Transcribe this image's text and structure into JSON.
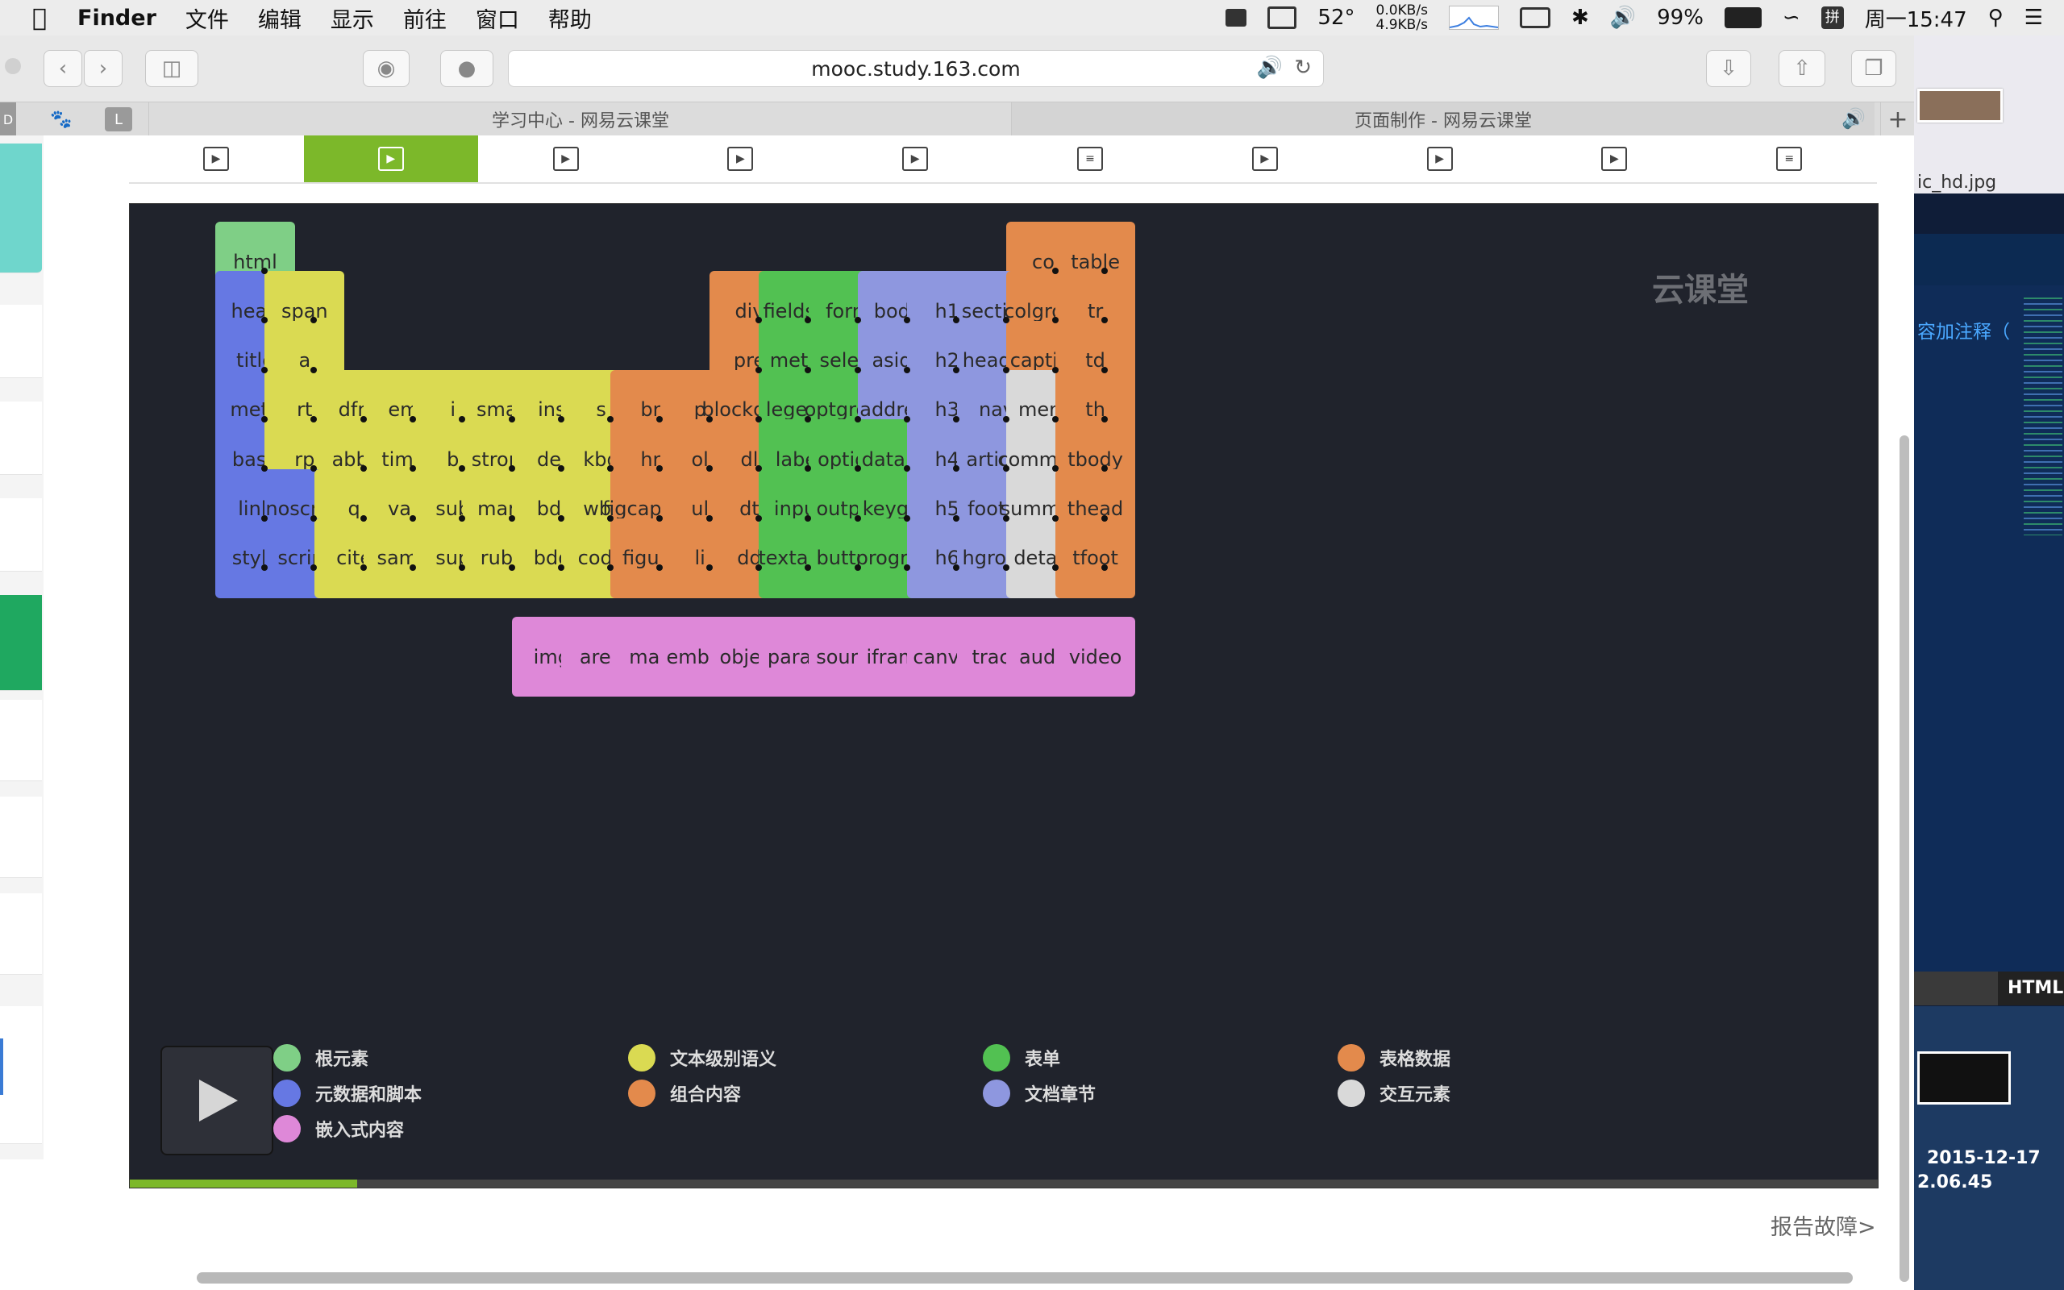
{
  "menubar": {
    "apple_icon": "apple-icon",
    "app_name": "Finder",
    "items": [
      "文件",
      "编辑",
      "显示",
      "前往",
      "窗口",
      "帮助"
    ],
    "temperature": "52°",
    "net_up": "0.0KB/s",
    "net_down": "4.9KB/s",
    "battery": "99%",
    "clock": "周一15:47"
  },
  "browser": {
    "url": "mooc.study.163.com",
    "tabs": [
      {
        "label": "学习中心 - 网易云课堂"
      },
      {
        "label": "页面制作 - 网易云课堂"
      }
    ],
    "new_tab": "+"
  },
  "lesson_tabs": [
    {
      "type": "video",
      "active": false
    },
    {
      "type": "video",
      "active": true
    },
    {
      "type": "video",
      "active": false
    },
    {
      "type": "video",
      "active": false
    },
    {
      "type": "video",
      "active": false
    },
    {
      "type": "doc",
      "active": false
    },
    {
      "type": "video",
      "active": false
    },
    {
      "type": "video",
      "active": false
    },
    {
      "type": "video",
      "active": false
    },
    {
      "type": "doc",
      "active": false
    }
  ],
  "video": {
    "watermark": "云课堂",
    "categories": {
      "root": "#7fcf86",
      "meta": "#6678e3",
      "text": "#dada52",
      "group": "#e38a4c",
      "form": "#52c152",
      "section": "#8e97df",
      "table": "#e38a4c",
      "interactive": "#d9d9d9",
      "embed": "#de88d8"
    },
    "elements": [
      {
        "tag": "html",
        "row": 0,
        "col": 0,
        "cat": "root"
      },
      {
        "tag": "col",
        "row": 0,
        "col": 16,
        "cat": "table"
      },
      {
        "tag": "table",
        "row": 0,
        "col": 17,
        "cat": "table"
      },
      {
        "tag": "head",
        "row": 1,
        "col": 0,
        "cat": "meta"
      },
      {
        "tag": "span",
        "row": 1,
        "col": 1,
        "cat": "text"
      },
      {
        "tag": "div",
        "row": 1,
        "col": 10,
        "cat": "group"
      },
      {
        "tag": "fieldset",
        "row": 1,
        "col": 11,
        "cat": "form"
      },
      {
        "tag": "form",
        "row": 1,
        "col": 12,
        "cat": "form"
      },
      {
        "tag": "body",
        "row": 1,
        "col": 13,
        "cat": "section"
      },
      {
        "tag": "h1",
        "row": 1,
        "col": 14,
        "cat": "section"
      },
      {
        "tag": "section",
        "row": 1,
        "col": 15,
        "cat": "section"
      },
      {
        "tag": "colgroup",
        "row": 1,
        "col": 16,
        "cat": "table"
      },
      {
        "tag": "tr",
        "row": 1,
        "col": 17,
        "cat": "table"
      },
      {
        "tag": "title",
        "row": 2,
        "col": 0,
        "cat": "meta"
      },
      {
        "tag": "a",
        "row": 2,
        "col": 1,
        "cat": "text"
      },
      {
        "tag": "pre",
        "row": 2,
        "col": 10,
        "cat": "group"
      },
      {
        "tag": "meter",
        "row": 2,
        "col": 11,
        "cat": "form"
      },
      {
        "tag": "select",
        "row": 2,
        "col": 12,
        "cat": "form"
      },
      {
        "tag": "aside",
        "row": 2,
        "col": 13,
        "cat": "section"
      },
      {
        "tag": "h2",
        "row": 2,
        "col": 14,
        "cat": "section"
      },
      {
        "tag": "header",
        "row": 2,
        "col": 15,
        "cat": "section"
      },
      {
        "tag": "caption",
        "row": 2,
        "col": 16,
        "cat": "table"
      },
      {
        "tag": "td",
        "row": 2,
        "col": 17,
        "cat": "table"
      },
      {
        "tag": "meta",
        "row": 3,
        "col": 0,
        "cat": "meta"
      },
      {
        "tag": "rt",
        "row": 3,
        "col": 1,
        "cat": "text"
      },
      {
        "tag": "dfn",
        "row": 3,
        "col": 2,
        "cat": "text"
      },
      {
        "tag": "em",
        "row": 3,
        "col": 3,
        "cat": "text"
      },
      {
        "tag": "i",
        "row": 3,
        "col": 4,
        "cat": "text"
      },
      {
        "tag": "small",
        "row": 3,
        "col": 5,
        "cat": "text"
      },
      {
        "tag": "ins",
        "row": 3,
        "col": 6,
        "cat": "text"
      },
      {
        "tag": "s",
        "row": 3,
        "col": 7,
        "cat": "text"
      },
      {
        "tag": "br",
        "row": 3,
        "col": 8,
        "cat": "group"
      },
      {
        "tag": "p",
        "row": 3,
        "col": 9,
        "cat": "group"
      },
      {
        "tag": "blockquot",
        "row": 3,
        "col": 10,
        "cat": "group"
      },
      {
        "tag": "legend",
        "row": 3,
        "col": 11,
        "cat": "form"
      },
      {
        "tag": "optgroup",
        "row": 3,
        "col": 12,
        "cat": "form"
      },
      {
        "tag": "address",
        "row": 3,
        "col": 13,
        "cat": "section"
      },
      {
        "tag": "h3",
        "row": 3,
        "col": 14,
        "cat": "section"
      },
      {
        "tag": "nav",
        "row": 3,
        "col": 15,
        "cat": "section"
      },
      {
        "tag": "menu",
        "row": 3,
        "col": 16,
        "cat": "interactive"
      },
      {
        "tag": "th",
        "row": 3,
        "col": 17,
        "cat": "table"
      },
      {
        "tag": "base",
        "row": 4,
        "col": 0,
        "cat": "meta"
      },
      {
        "tag": "rp",
        "row": 4,
        "col": 1,
        "cat": "text"
      },
      {
        "tag": "abbr",
        "row": 4,
        "col": 2,
        "cat": "text"
      },
      {
        "tag": "time",
        "row": 4,
        "col": 3,
        "cat": "text"
      },
      {
        "tag": "b",
        "row": 4,
        "col": 4,
        "cat": "text"
      },
      {
        "tag": "strong",
        "row": 4,
        "col": 5,
        "cat": "text"
      },
      {
        "tag": "del",
        "row": 4,
        "col": 6,
        "cat": "text"
      },
      {
        "tag": "kbd",
        "row": 4,
        "col": 7,
        "cat": "text"
      },
      {
        "tag": "hr",
        "row": 4,
        "col": 8,
        "cat": "group"
      },
      {
        "tag": "ol",
        "row": 4,
        "col": 9,
        "cat": "group"
      },
      {
        "tag": "dl",
        "row": 4,
        "col": 10,
        "cat": "group"
      },
      {
        "tag": "label",
        "row": 4,
        "col": 11,
        "cat": "form"
      },
      {
        "tag": "option",
        "row": 4,
        "col": 12,
        "cat": "form"
      },
      {
        "tag": "datalist",
        "row": 4,
        "col": 13,
        "cat": "form"
      },
      {
        "tag": "h4",
        "row": 4,
        "col": 14,
        "cat": "section"
      },
      {
        "tag": "article",
        "row": 4,
        "col": 15,
        "cat": "section"
      },
      {
        "tag": "command",
        "row": 4,
        "col": 16,
        "cat": "interactive"
      },
      {
        "tag": "tbody",
        "row": 4,
        "col": 17,
        "cat": "table"
      },
      {
        "tag": "link",
        "row": 5,
        "col": 0,
        "cat": "meta"
      },
      {
        "tag": "noscript",
        "row": 5,
        "col": 1,
        "cat": "meta"
      },
      {
        "tag": "q",
        "row": 5,
        "col": 2,
        "cat": "text"
      },
      {
        "tag": "var",
        "row": 5,
        "col": 3,
        "cat": "text"
      },
      {
        "tag": "sub",
        "row": 5,
        "col": 4,
        "cat": "text"
      },
      {
        "tag": "mark",
        "row": 5,
        "col": 5,
        "cat": "text"
      },
      {
        "tag": "bdi",
        "row": 5,
        "col": 6,
        "cat": "text"
      },
      {
        "tag": "wbr",
        "row": 5,
        "col": 7,
        "cat": "text"
      },
      {
        "tag": "figcaption",
        "row": 5,
        "col": 8,
        "cat": "group"
      },
      {
        "tag": "ul",
        "row": 5,
        "col": 9,
        "cat": "group"
      },
      {
        "tag": "dt",
        "row": 5,
        "col": 10,
        "cat": "group"
      },
      {
        "tag": "input",
        "row": 5,
        "col": 11,
        "cat": "form"
      },
      {
        "tag": "output",
        "row": 5,
        "col": 12,
        "cat": "form"
      },
      {
        "tag": "keygen",
        "row": 5,
        "col": 13,
        "cat": "form"
      },
      {
        "tag": "h5",
        "row": 5,
        "col": 14,
        "cat": "section"
      },
      {
        "tag": "footer",
        "row": 5,
        "col": 15,
        "cat": "section"
      },
      {
        "tag": "summary",
        "row": 5,
        "col": 16,
        "cat": "interactive"
      },
      {
        "tag": "thead",
        "row": 5,
        "col": 17,
        "cat": "table"
      },
      {
        "tag": "style",
        "row": 6,
        "col": 0,
        "cat": "meta"
      },
      {
        "tag": "script",
        "row": 6,
        "col": 1,
        "cat": "meta"
      },
      {
        "tag": "cite",
        "row": 6,
        "col": 2,
        "cat": "text"
      },
      {
        "tag": "samp",
        "row": 6,
        "col": 3,
        "cat": "text"
      },
      {
        "tag": "sup",
        "row": 6,
        "col": 4,
        "cat": "text"
      },
      {
        "tag": "ruby",
        "row": 6,
        "col": 5,
        "cat": "text"
      },
      {
        "tag": "bdo",
        "row": 6,
        "col": 6,
        "cat": "text"
      },
      {
        "tag": "code",
        "row": 6,
        "col": 7,
        "cat": "text"
      },
      {
        "tag": "figure",
        "row": 6,
        "col": 8,
        "cat": "group"
      },
      {
        "tag": "li",
        "row": 6,
        "col": 9,
        "cat": "group"
      },
      {
        "tag": "dd",
        "row": 6,
        "col": 10,
        "cat": "group"
      },
      {
        "tag": "textarea",
        "row": 6,
        "col": 11,
        "cat": "form"
      },
      {
        "tag": "button",
        "row": 6,
        "col": 12,
        "cat": "form"
      },
      {
        "tag": "progress",
        "row": 6,
        "col": 13,
        "cat": "form"
      },
      {
        "tag": "h6",
        "row": 6,
        "col": 14,
        "cat": "section"
      },
      {
        "tag": "hgroup",
        "row": 6,
        "col": 15,
        "cat": "section"
      },
      {
        "tag": "details",
        "row": 6,
        "col": 16,
        "cat": "interactive"
      },
      {
        "tag": "tfoot",
        "row": 6,
        "col": 17,
        "cat": "table"
      },
      {
        "tag": "img",
        "row": 8,
        "col": 6,
        "cat": "embed"
      },
      {
        "tag": "area",
        "row": 8,
        "col": 7,
        "cat": "embed"
      },
      {
        "tag": "map",
        "row": 8,
        "col": 8,
        "cat": "embed"
      },
      {
        "tag": "embed",
        "row": 8,
        "col": 9,
        "cat": "embed"
      },
      {
        "tag": "object",
        "row": 8,
        "col": 10,
        "cat": "embed"
      },
      {
        "tag": "param",
        "row": 8,
        "col": 11,
        "cat": "embed"
      },
      {
        "tag": "source",
        "row": 8,
        "col": 12,
        "cat": "embed"
      },
      {
        "tag": "iframe",
        "row": 8,
        "col": 13,
        "cat": "embed"
      },
      {
        "tag": "canvas",
        "row": 8,
        "col": 14,
        "cat": "embed"
      },
      {
        "tag": "track",
        "row": 8,
        "col": 15,
        "cat": "embed"
      },
      {
        "tag": "audio",
        "row": 8,
        "col": 16,
        "cat": "embed"
      },
      {
        "tag": "video",
        "row": 8,
        "col": 17,
        "cat": "embed"
      }
    ],
    "legend": [
      {
        "label": "根元素",
        "color": "#7fcf86"
      },
      {
        "label": "元数据和脚本",
        "color": "#6678e3"
      },
      {
        "label": "嵌入式内容",
        "color": "#de88d8"
      },
      {
        "label": "文本级别语义",
        "color": "#dada52"
      },
      {
        "label": "组合内容",
        "color": "#e38a4c"
      },
      {
        "label": "表单",
        "color": "#52c152"
      },
      {
        "label": "文档章节",
        "color": "#8e97df"
      },
      {
        "label": "表格数据",
        "color": "#e38a4c"
      },
      {
        "label": "交互元素",
        "color": "#d9d9d9"
      }
    ],
    "progress": 0.13
  },
  "report_link": "报告故障>",
  "desktop": {
    "file_label": "ic_hd.jpg",
    "note_text": "容加注释（",
    "html_label": "HTML",
    "screenshot_date": "2015-12-17",
    "screenshot_time": "2.06.45"
  }
}
